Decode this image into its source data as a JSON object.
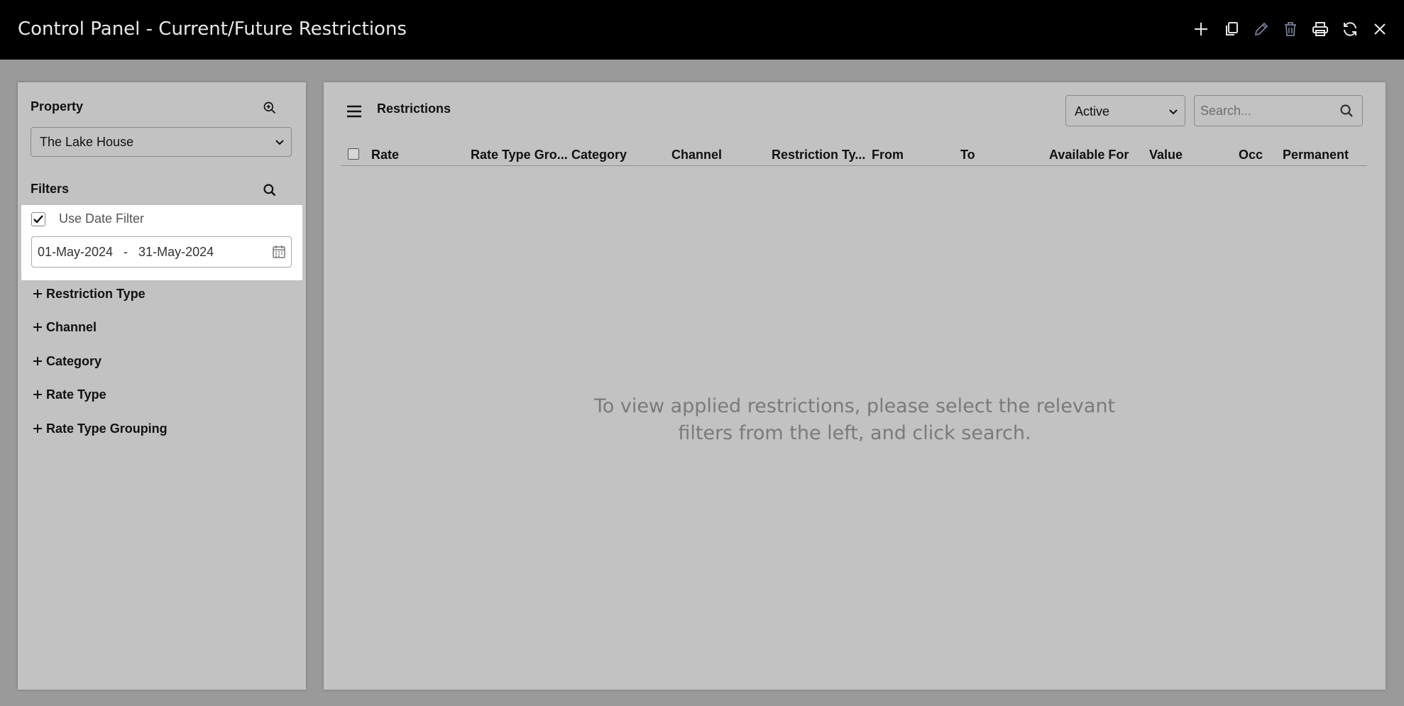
{
  "window": {
    "title": "Control Panel - Current/Future Restrictions",
    "toolbar_icons": [
      "plus-icon",
      "copy-icon",
      "edit-icon",
      "delete-icon",
      "print-icon",
      "refresh-icon",
      "close-icon"
    ]
  },
  "sidebar": {
    "property_label": "Property",
    "property_value": "The Lake House",
    "filters_label": "Filters",
    "date_filter": {
      "checked": true,
      "label": "Use Date Filter",
      "range_text": "01-May-2024   -   31-May-2024"
    },
    "filter_groups": [
      {
        "label": "Restriction Type"
      },
      {
        "label": "Channel"
      },
      {
        "label": "Category"
      },
      {
        "label": "Rate Type"
      },
      {
        "label": "Rate Type Grouping"
      }
    ]
  },
  "main": {
    "section_title": "Restrictions",
    "status_select": "Active",
    "search_placeholder": "Search...",
    "columns": [
      "Rate",
      "Rate Type Gro...",
      "Category",
      "Channel",
      "Restriction Ty...",
      "From",
      "To",
      "Available For",
      "Value",
      "Occ",
      "Permanent"
    ],
    "empty_message_line1": "To view applied restrictions, please select the relevant",
    "empty_message_line2": "filters from the left, and click search."
  },
  "colors": {
    "titlebar_bg": "#000000",
    "overlay_bg": "#9a9a9a",
    "panel_bg": "#c2c2c2",
    "highlight_card": "#ffffff"
  }
}
